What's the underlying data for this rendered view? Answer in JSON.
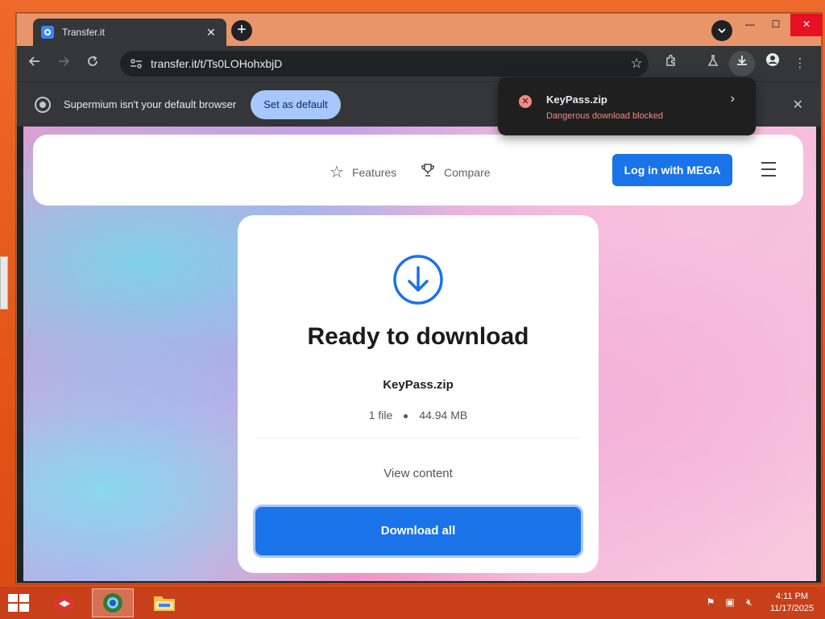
{
  "browser": {
    "tab_title": "Transfer.it",
    "tab_close": "✕",
    "new_tab": "+",
    "url": "transfer.it/t/Ts0LOHohxbjD",
    "infobar": {
      "message": "Supermium isn't your default browser",
      "button": "Set as default",
      "close": "✕"
    }
  },
  "download_toast": {
    "filename": "KeyPass.zip",
    "status": "Dangerous download blocked"
  },
  "site": {
    "nav": {
      "features": "Features",
      "compare": "Compare",
      "login": "Log in with MEGA"
    },
    "card": {
      "title": "Ready to download",
      "filename": "KeyPass.zip",
      "file_count": "1 file",
      "file_size": "44.94 MB",
      "view_content": "View content",
      "download_all": "Download all"
    }
  },
  "taskbar": {
    "time": "4:11 PM",
    "date": "11/17/2025"
  },
  "colors": {
    "accent": "#1a73e8",
    "danger": "#f28b82",
    "taskbar": "#c8401a"
  }
}
